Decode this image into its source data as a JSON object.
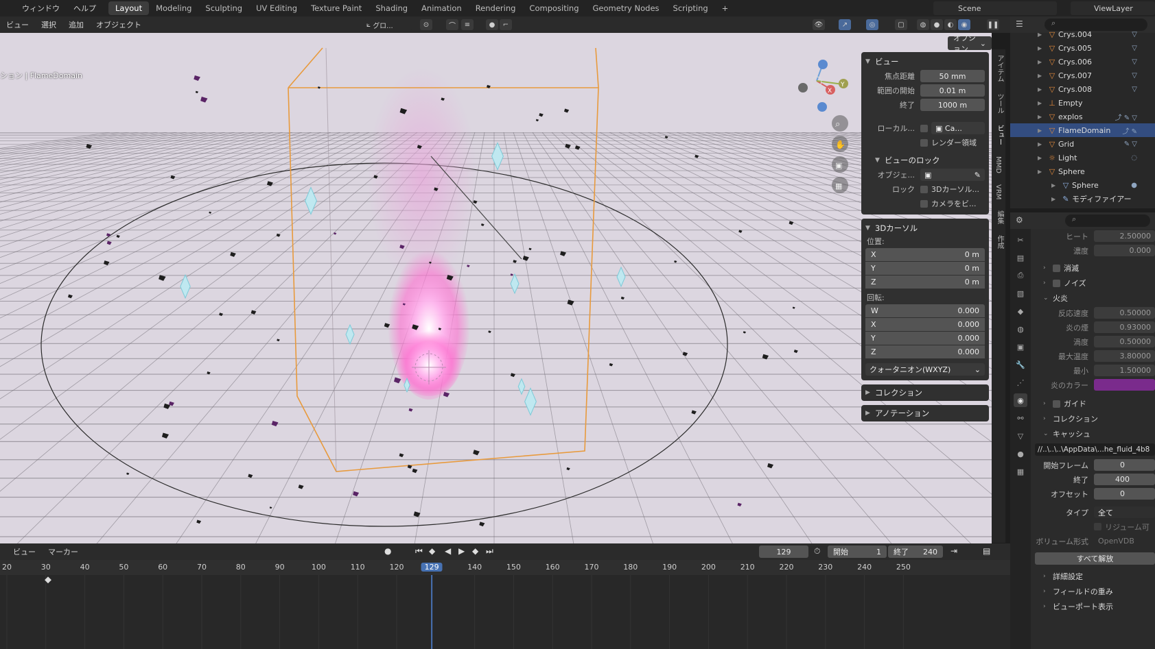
{
  "topbar": {
    "menus": [
      "ウィンドウ",
      "ヘルプ"
    ],
    "workspaces": [
      "Layout",
      "Modeling",
      "Sculpting",
      "UV Editing",
      "Texture Paint",
      "Shading",
      "Animation",
      "Rendering",
      "Compositing",
      "Geometry Nodes",
      "Scripting"
    ],
    "active_workspace": "Layout",
    "add_tab": "+",
    "scene": "Scene",
    "view_layer": "ViewLayer"
  },
  "viewport_header": {
    "menus": [
      "ビュー",
      "選択",
      "追加",
      "オブジェクト"
    ],
    "transform_orientation": "グロ...",
    "options_button": "オプション"
  },
  "viewport": {
    "object_label": "ション | FlameDomain",
    "gizmo": {
      "x": "X",
      "y": "Y"
    }
  },
  "ntabs": [
    "アイテム",
    "ツール",
    "ビュー",
    "MMD",
    "VRM",
    "編集",
    "作成"
  ],
  "npanel": {
    "view": {
      "title": "ビュー",
      "focal_label": "焦点距離",
      "focal_value": "50 mm",
      "clip_start_label": "範囲の開始",
      "clip_start_value": "0.01 m",
      "clip_end_label": "終了",
      "clip_end_value": "1000 m",
      "local_label": "ローカル...",
      "local_value": "Ca...",
      "render_region": "レンダー領域",
      "view_lock_title": "ビューのロック",
      "lock_object_label": "オブジェ...",
      "lock_label": "ロック",
      "lock_cursor": "3Dカーソル...",
      "lock_camera": "カメラをビ..."
    },
    "cursor": {
      "title": "3Dカーソル",
      "location_label": "位置:",
      "x": "0 m",
      "y": "0 m",
      "z": "0 m",
      "rotation_label": "回転:",
      "rw": "0.000",
      "rx": "0.000",
      "ry": "0.000",
      "rz": "0.000",
      "mode": "クォータニオン(WXYZ)"
    },
    "collection_title": "コレクション",
    "annotation_title": "アノテーション"
  },
  "outliner": {
    "items": [
      {
        "name": "Crys.004",
        "icon": "▽",
        "sel": false,
        "ext": "▽"
      },
      {
        "name": "Crys.005",
        "icon": "▽",
        "sel": false,
        "ext": "▽"
      },
      {
        "name": "Crys.006",
        "icon": "▽",
        "sel": false,
        "ext": "▽"
      },
      {
        "name": "Crys.007",
        "icon": "▽",
        "sel": false,
        "ext": "▽"
      },
      {
        "name": "Crys.008",
        "icon": "▽",
        "sel": false,
        "ext": "▽"
      },
      {
        "name": "Empty",
        "icon": "⊥",
        "sel": false,
        "ext": ""
      },
      {
        "name": "explos",
        "icon": "▽",
        "sel": false,
        "ext": "⤴ ✎ ▽"
      },
      {
        "name": "FlameDomain",
        "icon": "▽",
        "sel": true,
        "ext": "⤴ ✎"
      },
      {
        "name": "Grid",
        "icon": "▽",
        "sel": false,
        "ext": "✎ ▽"
      },
      {
        "name": "Light",
        "icon": "☼",
        "sel": false,
        "ext": "◌"
      },
      {
        "name": "Sphere",
        "icon": "▽",
        "sel": false,
        "ext": ""
      },
      {
        "name": "Sphere",
        "icon": "▽",
        "sel": false,
        "ext": "●",
        "indent": true
      },
      {
        "name": "モディファイアー",
        "icon": "✎",
        "sel": false,
        "ext": "",
        "indent": true
      }
    ]
  },
  "properties": {
    "heat_label": "ヒート",
    "heat_value": "2.50000",
    "density_label": "濃度",
    "density_value": "0.000",
    "dissolve": "消滅",
    "noise": "ノイズ",
    "fire": "火炎",
    "reaction_label": "反応速度",
    "reaction_value": "0.50000",
    "smoke_label": "炎の煙",
    "smoke_value": "0.93000",
    "vorticity_label": "渦度",
    "vorticity_value": "0.50000",
    "maxtemp_label": "最大温度",
    "maxtemp_value": "3.80000",
    "min_label": "最小",
    "min_value": "1.50000",
    "flame_color_label": "炎のカラー",
    "flame_color": "#7a2b8c",
    "guide": "ガイド",
    "collection": "コレクション",
    "cache": "キャッシュ",
    "cache_path": "//..\\..\\..\\AppData\\...he_fluid_4b8",
    "frame_start_label": "開始フレーム",
    "frame_start_value": "0",
    "frame_end_label": "終了",
    "frame_end_value": "400",
    "offset_label": "オフセット",
    "offset_value": "0",
    "type_label": "タイプ",
    "type_value": "全て",
    "resumable": "リジューム可",
    "volume_format_label": "ボリューム形式",
    "volume_format_value": "OpenVDB",
    "free_all": "すべて解放",
    "advanced": "詳細設定",
    "field_weights": "フィールドの重み",
    "viewport_display": "ビューポート表示"
  },
  "timeline": {
    "menus": [
      "ビュー",
      "マーカー"
    ],
    "current_frame": "129",
    "start_label": "開始",
    "start_value": "1",
    "end_label": "終了",
    "end_value": "240",
    "ticks": [
      "20",
      "30",
      "40",
      "50",
      "60",
      "70",
      "80",
      "90",
      "100",
      "110",
      "120",
      "129",
      "140",
      "150",
      "160",
      "170",
      "180",
      "190",
      "200",
      "210",
      "220",
      "230",
      "240",
      "250"
    ]
  },
  "colors": {
    "accent": "#4772b3",
    "selection": "#334d80",
    "domain_outline": "#e89a3c",
    "flame": "#ff8ad8"
  }
}
